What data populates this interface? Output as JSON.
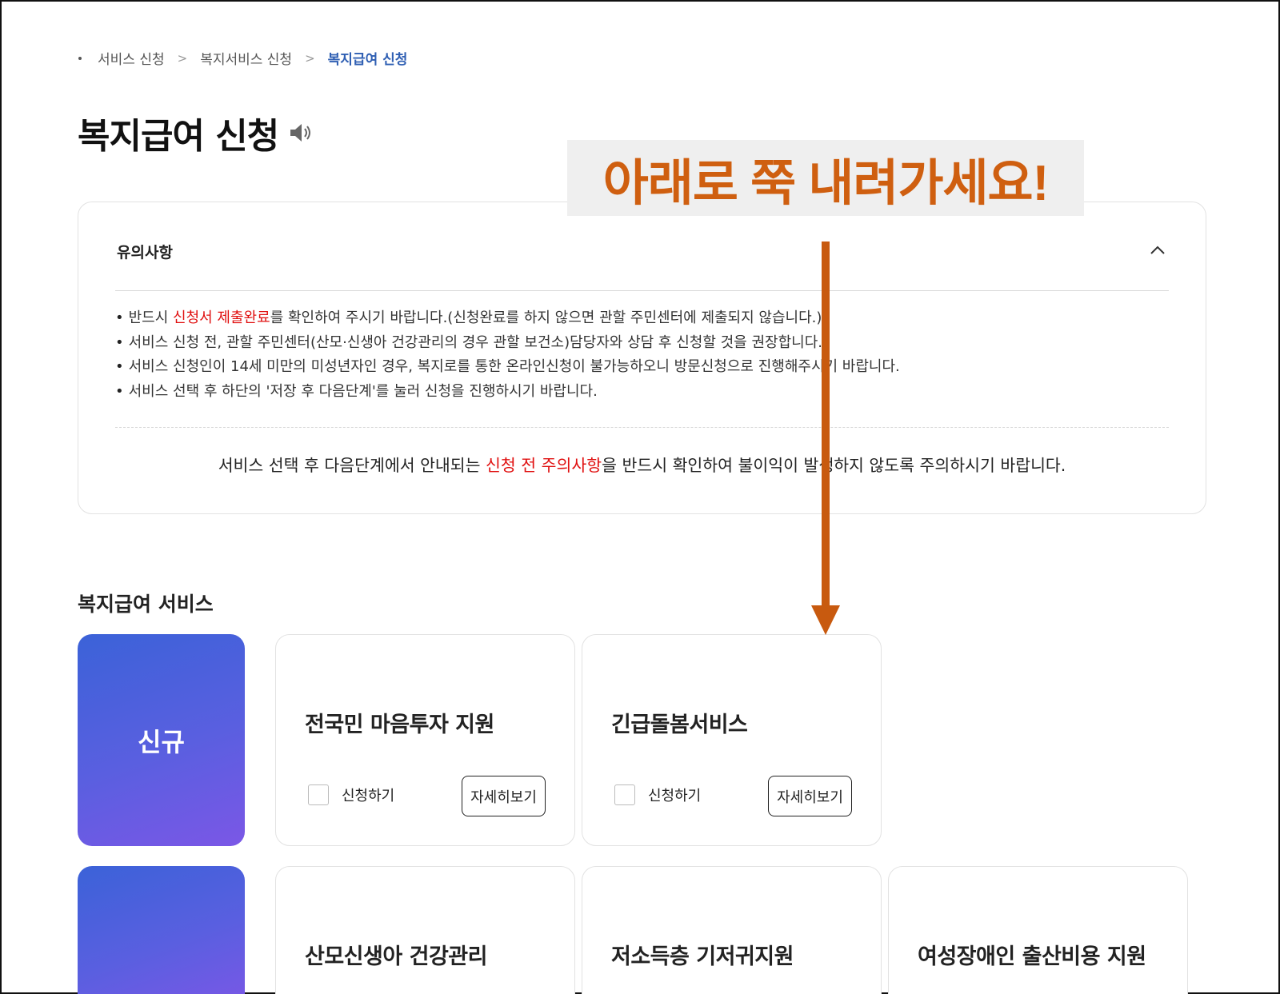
{
  "breadcrumb": {
    "items": [
      "서비스 신청",
      "복지서비스 신청",
      "복지급여 신청"
    ],
    "separator": ">"
  },
  "page": {
    "title": "복지급여 신청",
    "speaker_icon": "speaker-icon"
  },
  "notice": {
    "header": "유의사항",
    "bullets": [
      {
        "pre": "반드시 ",
        "highlight": "신청서 제출완료",
        "post": "를 확인하여 주시기 바랍니다.(신청완료를 하지 않으면 관할 주민센터에 제출되지 않습니다.)"
      },
      {
        "pre": "서비스 신청 전, 관할 주민센터(산모·신생아 건강관리의 경우 관할 보건소)담당자와 상담 후 신청할 것을 권장합니다.",
        "highlight": "",
        "post": ""
      },
      {
        "pre": "서비스 신청인이 14세 미만의 미성년자인 경우, 복지로를 통한 온라인신청이 불가능하오니 방문신청으로 진행해주시기 바랍니다.",
        "highlight": "",
        "post": ""
      },
      {
        "pre": "서비스 선택 후 하단의 '저장 후 다음단계'를 눌러 신청을 진행하시기 바랍니다.",
        "highlight": "",
        "post": ""
      }
    ],
    "bottom": {
      "pre": "서비스 선택 후 다음단계에서 안내되는 ",
      "highlight": "신청 전 주의사항",
      "post": "을 반드시 확인하여 불이익이 발생하지 않도록 주의하시기 바랍니다."
    },
    "highlight_color": "#e01010"
  },
  "section": {
    "title": "복지급여 서비스",
    "new_badge": "신규",
    "row1": [
      {
        "title": "전국민 마음투자 지원",
        "checkbox_label": "신청하기",
        "detail_label": "자세히보기"
      },
      {
        "title": "긴급돌봄서비스",
        "checkbox_label": "신청하기",
        "detail_label": "자세히보기"
      }
    ],
    "row2": [
      {
        "title": "산모신생아 건강관리"
      },
      {
        "title": "저소득층 기저귀지원"
      },
      {
        "title": "여성장애인 출산비용 지원"
      }
    ]
  },
  "overlay": {
    "banner_text": "아래로 쭉 내려가세요!",
    "banner_color": "#cf5f10"
  },
  "colors": {
    "accent_blue": "#2f5fb3",
    "badge_gradient_start": "#3b62d8",
    "badge_gradient_end": "#7b57e6"
  }
}
